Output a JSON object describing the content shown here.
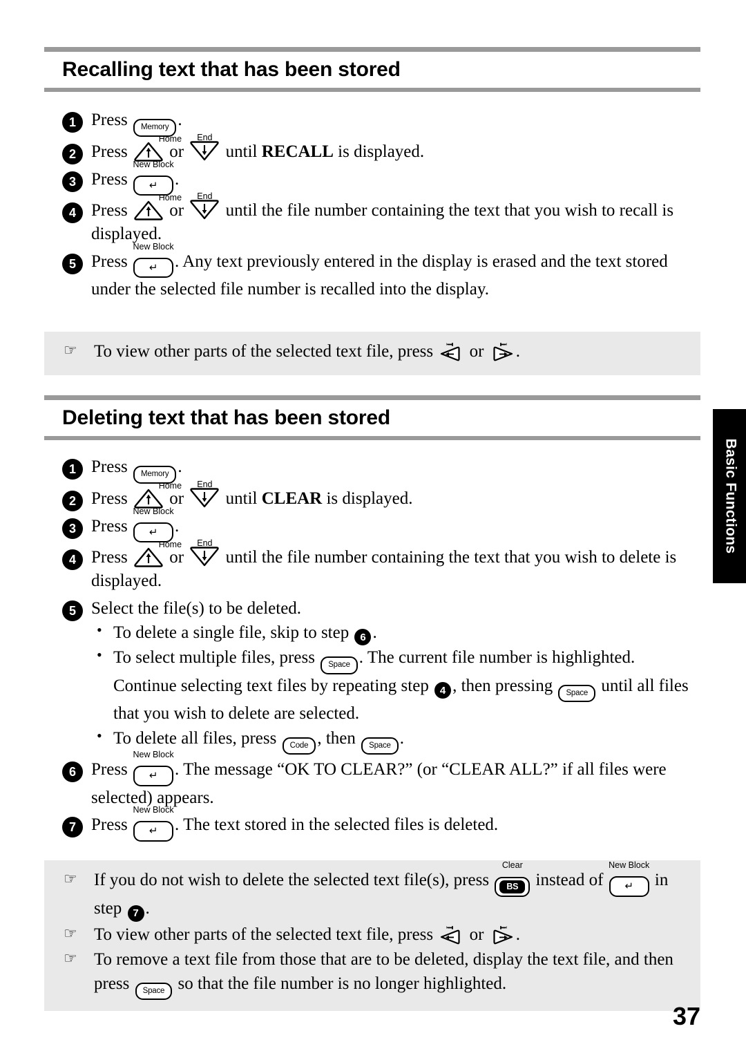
{
  "page": {
    "number": "37",
    "side_tab_label": "Basic Functions"
  },
  "keys": {
    "memory": "Memory",
    "new_block_label": "New Block",
    "enter_glyph": "↵",
    "home_label": "Home",
    "end_label": "End",
    "up_glyph": "↑",
    "down_glyph": "↓",
    "left_glyph": "←",
    "right_glyph": "→",
    "space": "Space",
    "code": "Code",
    "bs": "BS",
    "clear_label": "Clear"
  },
  "hand_glyph": "☞",
  "sections": [
    {
      "id": "recalling",
      "title": "Recalling text that has been stored",
      "steps": [
        {
          "n": "1",
          "parts": [
            {
              "t": "text",
              "v": "Press "
            },
            {
              "t": "key-memory"
            },
            {
              "t": "text",
              "v": "."
            }
          ]
        },
        {
          "n": "2",
          "parts": [
            {
              "t": "text",
              "v": "Press "
            },
            {
              "t": "key-up-home"
            },
            {
              "t": "text",
              "v": " or "
            },
            {
              "t": "key-down-end"
            },
            {
              "t": "text",
              "v": " until "
            },
            {
              "t": "bold",
              "v": "RECALL"
            },
            {
              "t": "text",
              "v": " is displayed."
            }
          ]
        },
        {
          "n": "3",
          "parts": [
            {
              "t": "text",
              "v": "Press "
            },
            {
              "t": "key-newblock"
            },
            {
              "t": "text",
              "v": "."
            }
          ]
        },
        {
          "n": "4",
          "parts": [
            {
              "t": "text",
              "v": "Press "
            },
            {
              "t": "key-up-home"
            },
            {
              "t": "text",
              "v": " or "
            },
            {
              "t": "key-down-end"
            },
            {
              "t": "text",
              "v": " until the file number containing the text that you wish to recall is displayed."
            }
          ]
        },
        {
          "n": "5",
          "parts": [
            {
              "t": "text",
              "v": "Press "
            },
            {
              "t": "key-newblock"
            },
            {
              "t": "text",
              "v": ". Any text previously entered in the display is erased and the text stored under the selected file number is recalled into the display."
            }
          ]
        }
      ],
      "notes": [
        {
          "parts": [
            {
              "t": "text",
              "v": "To view other parts of the selected text file, press "
            },
            {
              "t": "key-left"
            },
            {
              "t": "text",
              "v": " or "
            },
            {
              "t": "key-right"
            },
            {
              "t": "text",
              "v": "."
            }
          ]
        }
      ]
    },
    {
      "id": "deleting",
      "title": "Deleting text that has been stored",
      "steps": [
        {
          "n": "1",
          "parts": [
            {
              "t": "text",
              "v": "Press "
            },
            {
              "t": "key-memory"
            },
            {
              "t": "text",
              "v": "."
            }
          ]
        },
        {
          "n": "2",
          "parts": [
            {
              "t": "text",
              "v": "Press "
            },
            {
              "t": "key-up-home"
            },
            {
              "t": "text",
              "v": " or "
            },
            {
              "t": "key-down-end"
            },
            {
              "t": "text",
              "v": " until "
            },
            {
              "t": "bold",
              "v": "CLEAR"
            },
            {
              "t": "text",
              "v": " is displayed."
            }
          ]
        },
        {
          "n": "3",
          "parts": [
            {
              "t": "text",
              "v": "Press "
            },
            {
              "t": "key-newblock"
            },
            {
              "t": "text",
              "v": "."
            }
          ]
        },
        {
          "n": "4",
          "parts": [
            {
              "t": "text",
              "v": "Press "
            },
            {
              "t": "key-up-home"
            },
            {
              "t": "text",
              "v": " or "
            },
            {
              "t": "key-down-end"
            },
            {
              "t": "text",
              "v": " until the file number containing the text that you wish to delete is displayed."
            }
          ]
        },
        {
          "n": "5",
          "parts": [
            {
              "t": "text",
              "v": "Select the file(s) to be deleted."
            }
          ],
          "bullets": [
            {
              "parts": [
                {
                  "t": "text",
                  "v": "To delete a single file, skip to step "
                },
                {
                  "t": "badge",
                  "v": "6"
                },
                {
                  "t": "text",
                  "v": "."
                }
              ]
            },
            {
              "parts": [
                {
                  "t": "text",
                  "v": "To select multiple files, press "
                },
                {
                  "t": "key-space"
                },
                {
                  "t": "text",
                  "v": ". The current file number is highlighted. Continue selecting text files by repeating step "
                },
                {
                  "t": "badge",
                  "v": "4"
                },
                {
                  "t": "text",
                  "v": ", then pressing "
                },
                {
                  "t": "key-space"
                },
                {
                  "t": "text",
                  "v": " until all files that you wish to delete are selected."
                }
              ]
            },
            {
              "parts": [
                {
                  "t": "text",
                  "v": "To delete all files, press "
                },
                {
                  "t": "key-code"
                },
                {
                  "t": "text",
                  "v": ", then "
                },
                {
                  "t": "key-space"
                },
                {
                  "t": "text",
                  "v": "."
                }
              ]
            }
          ]
        },
        {
          "n": "6",
          "parts": [
            {
              "t": "text",
              "v": "Press "
            },
            {
              "t": "key-newblock"
            },
            {
              "t": "text",
              "v": ". The message “OK TO CLEAR?” (or “CLEAR ALL?” if all files were selected) appears."
            }
          ]
        },
        {
          "n": "7",
          "parts": [
            {
              "t": "text",
              "v": "Press "
            },
            {
              "t": "key-newblock"
            },
            {
              "t": "text",
              "v": ". The text stored in the selected files is deleted."
            }
          ]
        }
      ],
      "notes": [
        {
          "parts": [
            {
              "t": "text",
              "v": "If you do not wish to delete the selected text file(s), press "
            },
            {
              "t": "key-bs"
            },
            {
              "t": "text",
              "v": " instead of "
            },
            {
              "t": "key-newblock"
            },
            {
              "t": "text",
              "v": " in step "
            },
            {
              "t": "badge",
              "v": "7"
            },
            {
              "t": "text",
              "v": "."
            }
          ]
        },
        {
          "parts": [
            {
              "t": "text",
              "v": "To view other parts of the selected text file, press "
            },
            {
              "t": "key-left"
            },
            {
              "t": "text",
              "v": " or "
            },
            {
              "t": "key-right"
            },
            {
              "t": "text",
              "v": "."
            }
          ]
        },
        {
          "parts": [
            {
              "t": "text",
              "v": "To remove a text file from those that are to be deleted, display the text file, and then press "
            },
            {
              "t": "key-space"
            },
            {
              "t": "text",
              "v": " so that the file number is no longer highlighted."
            }
          ]
        }
      ]
    }
  ]
}
